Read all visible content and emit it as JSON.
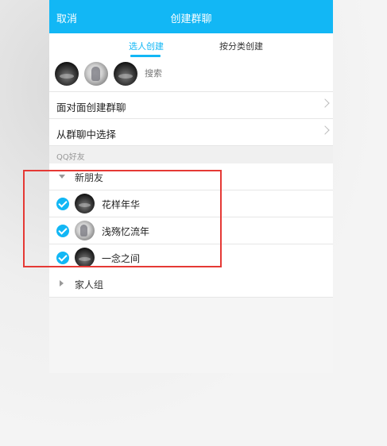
{
  "header": {
    "cancel_label": "取消",
    "title": "创建群聊"
  },
  "tabs": [
    {
      "label": "选人创建",
      "active": true
    },
    {
      "label": "按分类创建",
      "active": false
    }
  ],
  "selected_avatars": [
    "dark-avatar",
    "anime-avatar",
    "dark-avatar"
  ],
  "search": {
    "placeholder": "搜索"
  },
  "menu": [
    {
      "label": "面对面创建群聊"
    },
    {
      "label": "从群聊中选择"
    }
  ],
  "section_title": "QQ好友",
  "groups": [
    {
      "label": "新朋友",
      "expanded": true,
      "friends": [
        {
          "name": "花样年华",
          "checked": true,
          "avatar": "dark-avatar"
        },
        {
          "name": "浅殇忆流年",
          "checked": true,
          "avatar": "anime-avatar"
        },
        {
          "name": "一念之间",
          "checked": true,
          "avatar": "dark-avatar"
        }
      ]
    },
    {
      "label": "家人组",
      "expanded": false
    }
  ],
  "colors": {
    "accent": "#12b7f5",
    "highlight": "#e53935"
  }
}
